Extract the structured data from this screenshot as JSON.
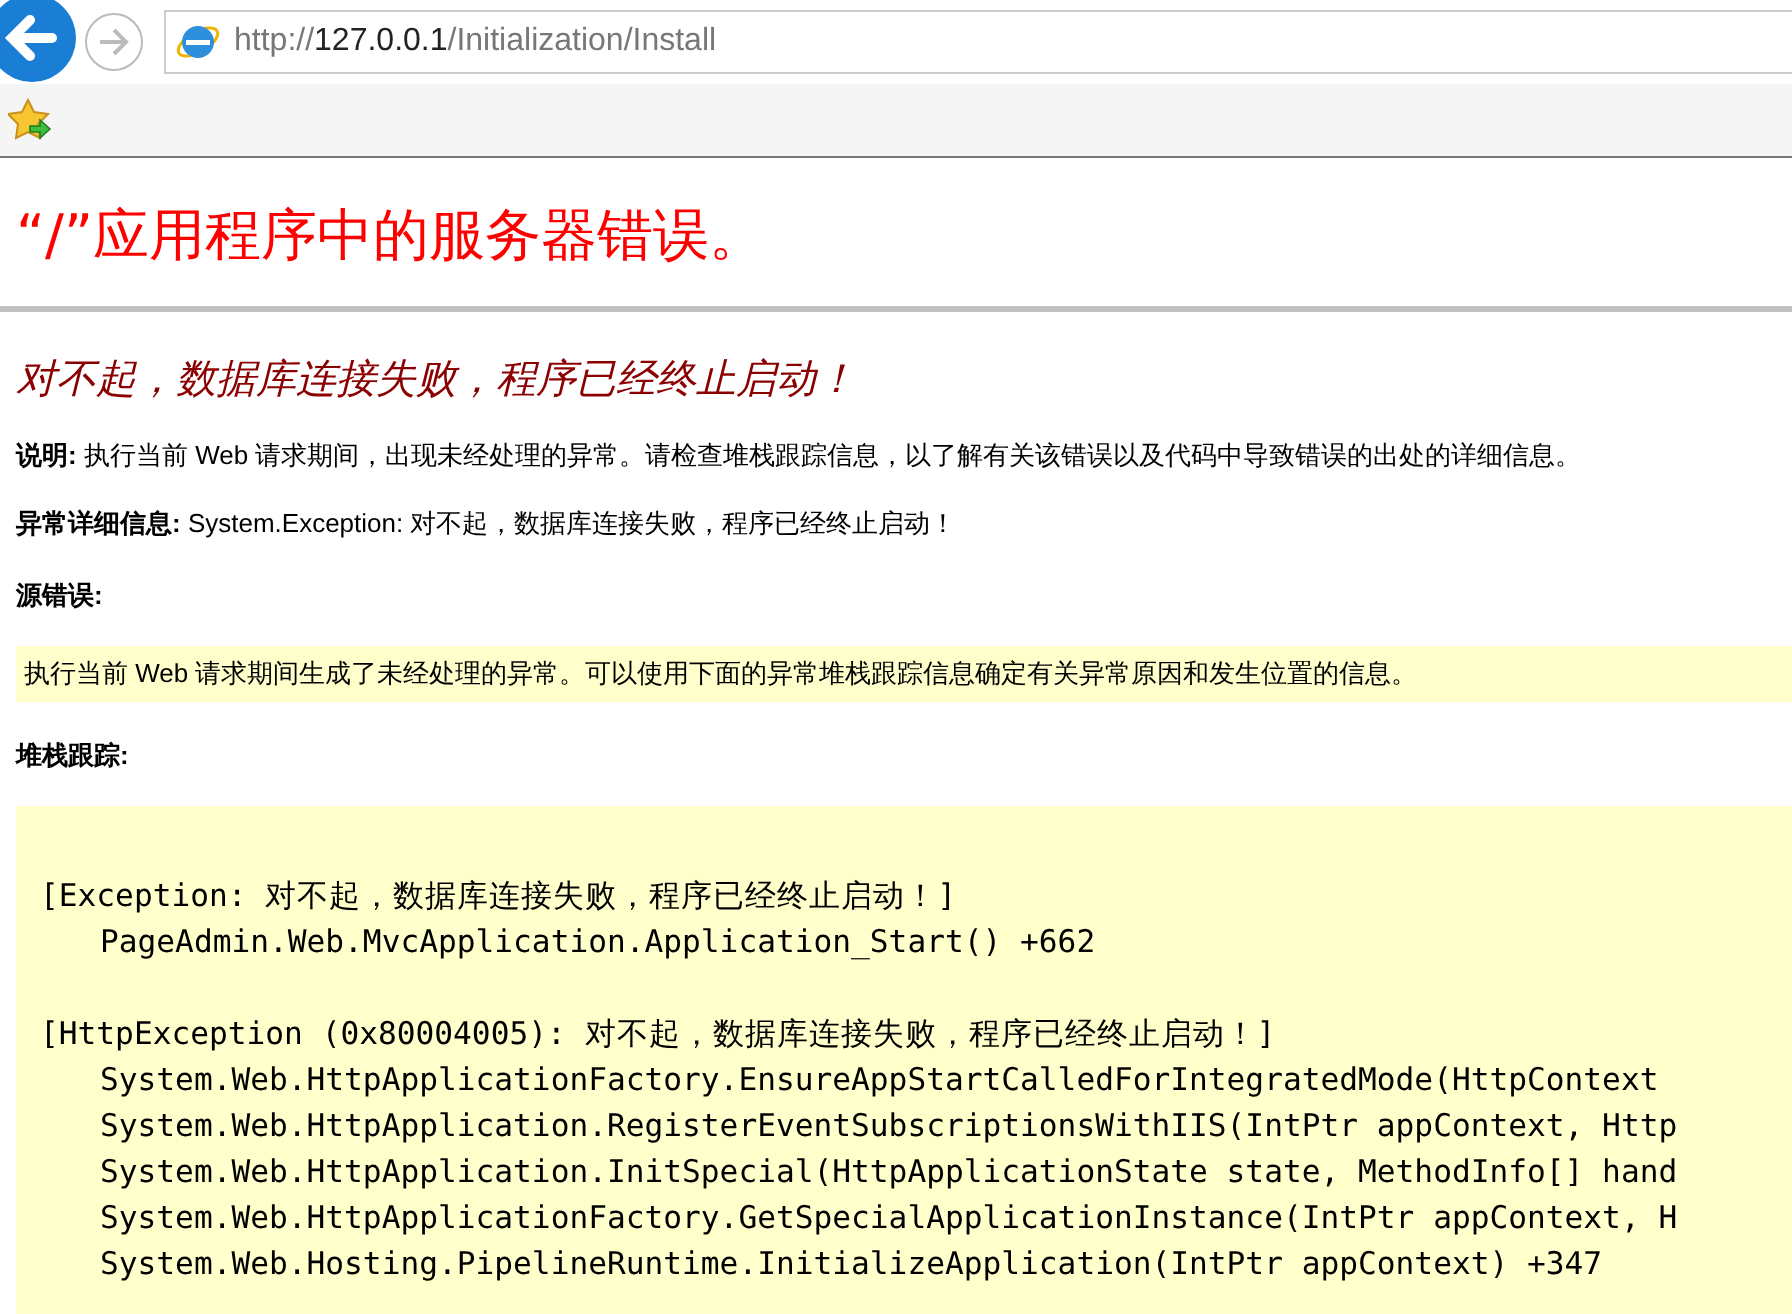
{
  "browser": {
    "address": {
      "scheme": "http://",
      "host": "127.0.0.1",
      "path": "/Initialization/Install"
    }
  },
  "page": {
    "title": "“/”应用程序中的服务器错误。",
    "message": "对不起，数据库连接失败，程序已经终止启动！",
    "description": "**说明:** 执行当前 Web 请求期间，出现未经处理的异常。请检查堆栈跟踪信息，以了解有关该错误以及代码中导致错误的出处的详细信息。",
    "exception_details": "**异常详细信息:** System.Exception: 对不起，数据库连接失败，程序已经终止启动！",
    "source_error_label": "源错误:",
    "source_error_text": "执行当前 Web 请求期间生成了未经处理的异常。可以使用下面的异常堆栈跟踪信息确定有关异常原因和发生位置的信息。",
    "stack_trace_label": "堆栈跟踪:",
    "stack_trace": [
      {
        "header": "[Exception: 对不起，数据库连接失败，程序已经终止启动！]",
        "frames": [
          "PageAdmin.Web.MvcApplication.Application_Start() +662"
        ]
      },
      {
        "header": "[HttpException (0x80004005): 对不起，数据库连接失败，程序已经终止启动！]",
        "frames": [
          "System.Web.HttpApplicationFactory.EnsureAppStartCalledForIntegratedMode(HttpContext",
          "System.Web.HttpApplication.RegisterEventSubscriptionsWithIIS(IntPtr appContext, Http",
          "System.Web.HttpApplication.InitSpecial(HttpApplicationState state, MethodInfo[] hand",
          "System.Web.HttpApplicationFactory.GetSpecialApplicationInstance(IntPtr appContext, H",
          "System.Web.Hosting.PipelineRuntime.InitializeApplication(IntPtr appContext) +347"
        ]
      }
    ]
  }
}
